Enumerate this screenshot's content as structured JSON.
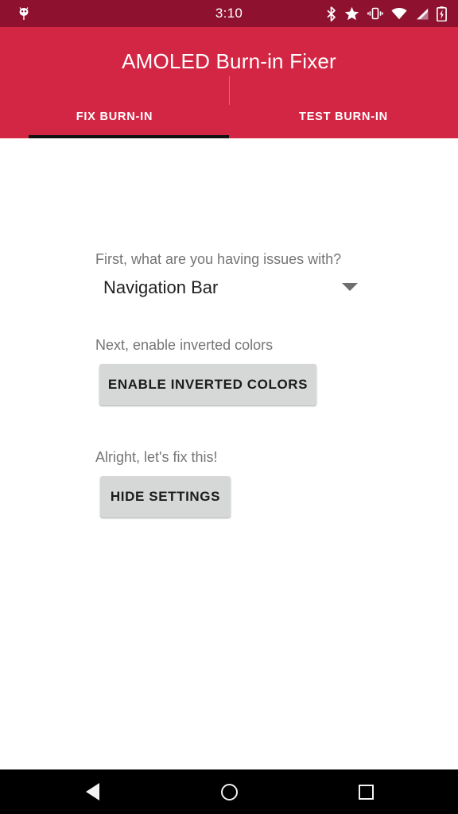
{
  "status_bar": {
    "clock": "3:10",
    "left_icons": [
      {
        "name": "android-bug-icon",
        "glyph": "bug"
      }
    ],
    "right_icons": [
      {
        "name": "bluetooth-icon",
        "glyph": "bluetooth"
      },
      {
        "name": "star-icon",
        "glyph": "star"
      },
      {
        "name": "vibrate-icon",
        "glyph": "vibrate"
      },
      {
        "name": "wifi-icon",
        "glyph": "wifi"
      },
      {
        "name": "cell-signal-icon",
        "glyph": "signal"
      },
      {
        "name": "battery-charging-icon",
        "glyph": "battery"
      }
    ],
    "background_color": "#8E1230",
    "foreground_color": "#FFFFFF"
  },
  "app_bar": {
    "title": "AMOLED Burn-in Fixer",
    "background_color": "#D32644",
    "title_color": "#FFFFFF"
  },
  "tabs": {
    "selected_index": 0,
    "indicator_color": "#111111",
    "items": [
      {
        "label": "FIX BURN-IN"
      },
      {
        "label": "TEST BURN-IN"
      }
    ]
  },
  "main": {
    "steps": [
      {
        "label": "First, what are you having issues with?",
        "control": "spinner",
        "value": "Navigation Bar"
      },
      {
        "label": "Next, enable inverted colors",
        "control": "button",
        "button_label": "ENABLE INVERTED COLORS"
      },
      {
        "label": "Alright, let's fix this!",
        "control": "button",
        "button_label": "HIDE SETTINGS"
      }
    ],
    "label_color": "#757575",
    "button_color": "#D6D7D7",
    "background_color": "#FFFFFF"
  },
  "nav_bar": {
    "background_color": "#000000",
    "items": [
      {
        "name": "back",
        "label": "Back"
      },
      {
        "name": "home",
        "label": "Home"
      },
      {
        "name": "recents",
        "label": "Recents"
      }
    ]
  }
}
